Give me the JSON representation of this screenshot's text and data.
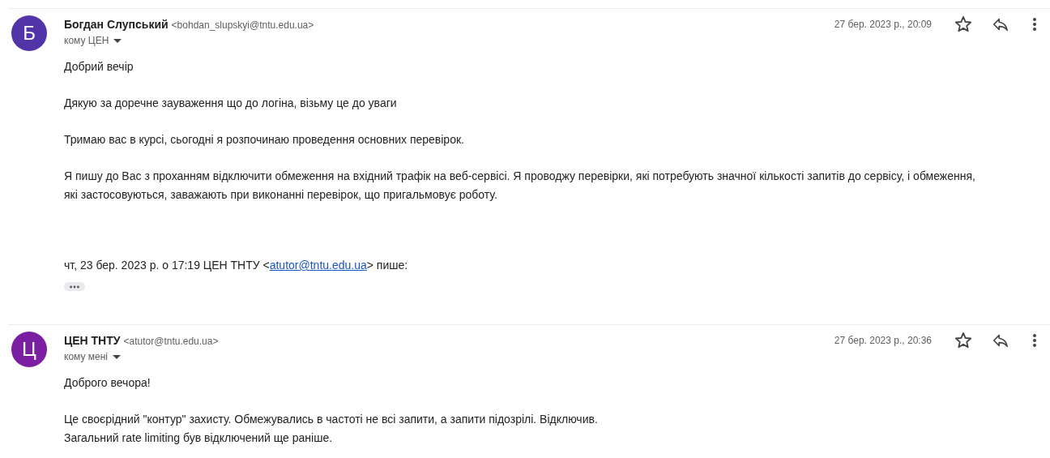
{
  "messages": [
    {
      "avatar": {
        "letter": "Б",
        "color": "#5233a8"
      },
      "sender": "Богдан Слупський",
      "email": "<bohdan_slupskyi@tntu.edu.ua>",
      "recipient": "кому ЦЕН",
      "date": "27 бер. 2023 р., 20:09",
      "starred": false,
      "paragraphs": [
        [
          "Добрий вечір"
        ],
        [
          "Дякую за доречне зауваження що до логіна, візьму це до уваги"
        ],
        [
          "Тримаю вас в курсі, сьогодні я розпочинаю проведення основних перевірок."
        ],
        [
          "Я пишу до Вас з проханням відключити обмеження на вхідний трафік на веб-сервісі. Я проводжу перевірки, які потребують значної кількості запитів до сервісу, і обмеження, які застосовуються, заважають при виконанні перевірок, що пригальмовує роботу."
        ]
      ],
      "quote": {
        "before": "чт, 23 бер. 2023 р. о 17:19 ЦЕН ТНТУ <",
        "link": "atutor@tntu.edu.ua",
        "after": "> пише:"
      },
      "trimmed": true
    },
    {
      "avatar": {
        "letter": "Ц",
        "color": "#7b1fa2"
      },
      "sender": "ЦЕН ТНТУ",
      "email": "<atutor@tntu.edu.ua>",
      "recipient": "кому мені",
      "date": "27 бер. 2023 р., 20:36",
      "starred": false,
      "paragraphs": [
        [
          "Доброго вечора!"
        ],
        [
          "Це своєрідний \"контур\" захисту. Обмежувались в частоті не всі запити, а запити підозрілі. Відключив.",
          "Загальний rate limiting був відключений ще раніше."
        ]
      ]
    }
  ]
}
